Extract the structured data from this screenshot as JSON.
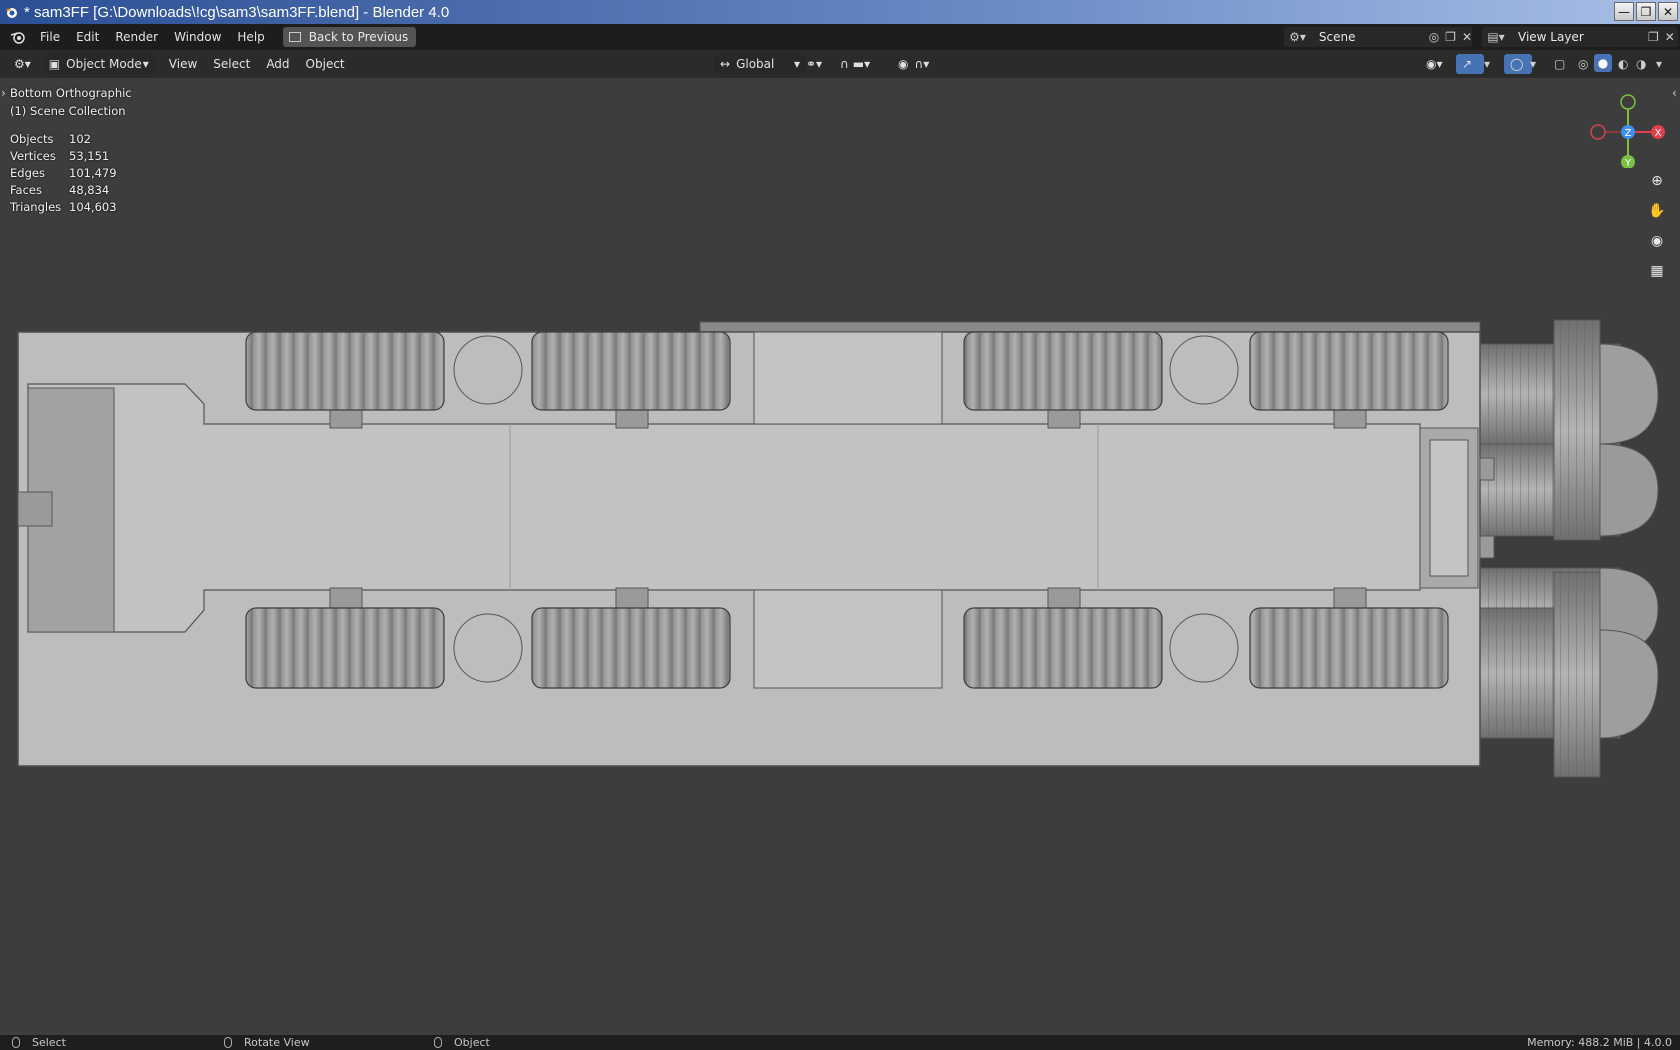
{
  "window": {
    "title": "* sam3FF [G:\\Downloads\\!cg\\sam3\\sam3FF.blend] - Blender 4.0",
    "min": "—",
    "max": "❐",
    "close": "✕"
  },
  "menubar": {
    "items": [
      "File",
      "Edit",
      "Render",
      "Window",
      "Help"
    ],
    "back_label": "Back to Previous",
    "scene": "Scene",
    "view_layer": "View Layer"
  },
  "header": {
    "mode": "Object Mode",
    "menus": [
      "View",
      "Select",
      "Add",
      "Object"
    ],
    "transform_orientation": "Global"
  },
  "viewport": {
    "view_name": "Bottom Orthographic",
    "collection": "(1) Scene Collection",
    "stats": [
      {
        "label": "Objects",
        "value": "102"
      },
      {
        "label": "Vertices",
        "value": "53,151"
      },
      {
        "label": "Edges",
        "value": "101,479"
      },
      {
        "label": "Faces",
        "value": "48,834"
      },
      {
        "label": "Triangles",
        "value": "104,603"
      }
    ],
    "gizmo": {
      "x": "X",
      "y": "Y",
      "z": "Z"
    }
  },
  "statusbar": {
    "select": "Select",
    "rotate": "Rotate View",
    "object": "Object",
    "memory": "Memory: 488.2 MiB | 4.0.0"
  },
  "colors": {
    "background": "#3d3d3d",
    "gizmo_x": "#e0404a",
    "gizmo_y": "#7ac143",
    "gizmo_z": "#3c8ef0",
    "accent_blue": "#4772b3"
  }
}
